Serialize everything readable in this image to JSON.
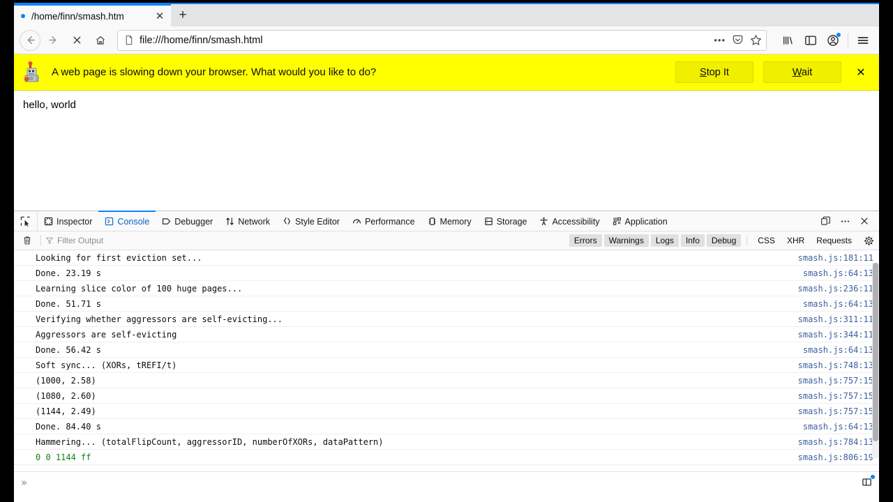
{
  "browser": {
    "tab": {
      "title": "/home/finn/smash.htm",
      "close_label": "✕",
      "loading_indicator": "loading-dot"
    },
    "new_tab_label": "+",
    "nav": {
      "back": "back-icon",
      "forward": "forward-icon",
      "stop": "stop-icon",
      "home": "home-icon"
    },
    "urlbar": {
      "value": "file:///home/finn/smash.html",
      "page_icon": "document-icon",
      "ellipsis": "•••",
      "pocket": "pocket-icon",
      "bookmark": "star-icon"
    },
    "toolbar_right": {
      "library": "library-icon",
      "sidebar": "sidebar-icon",
      "account": "account-icon",
      "menu": "hamburger-menu-icon"
    }
  },
  "notification": {
    "icon": "slow-script-robot-icon",
    "message": "A web page is slowing down your browser. What would you like to do?",
    "stop_button": {
      "prefix": "",
      "accesskey": "S",
      "rest": "top It"
    },
    "wait_button": {
      "prefix": "",
      "accesskey": "W",
      "rest": "ait"
    },
    "close_label": "✕",
    "background": "#ffff00"
  },
  "page": {
    "body_text": "hello, world"
  },
  "devtools": {
    "picker_icon": "element-picker-icon",
    "tabs": [
      {
        "label": "Inspector",
        "icon": "inspector-icon",
        "active": false
      },
      {
        "label": "Console",
        "icon": "console-icon",
        "active": true
      },
      {
        "label": "Debugger",
        "icon": "debugger-icon",
        "active": false
      },
      {
        "label": "Network",
        "icon": "network-icon",
        "active": false
      },
      {
        "label": "Style Editor",
        "icon": "style-editor-icon",
        "active": false
      },
      {
        "label": "Performance",
        "icon": "performance-icon",
        "active": false
      },
      {
        "label": "Memory",
        "icon": "memory-icon",
        "active": false
      },
      {
        "label": "Storage",
        "icon": "storage-icon",
        "active": false
      },
      {
        "label": "Accessibility",
        "icon": "accessibility-icon",
        "active": false
      },
      {
        "label": "Application",
        "icon": "application-icon",
        "active": false
      }
    ],
    "toolbar_right": {
      "dock": "dock-to-side-icon",
      "more": "meatball-menu-icon",
      "close": "close-icon"
    },
    "filterbar": {
      "clear_icon": "trash-icon",
      "filter_icon": "funnel-icon",
      "filter_placeholder": "Filter Output",
      "pills": [
        {
          "label": "Errors",
          "active": true
        },
        {
          "label": "Warnings",
          "active": true
        },
        {
          "label": "Logs",
          "active": true
        },
        {
          "label": "Info",
          "active": true
        },
        {
          "label": "Debug",
          "active": true
        },
        {
          "label": "CSS",
          "active": false
        },
        {
          "label": "XHR",
          "active": false
        },
        {
          "label": "Requests",
          "active": false
        }
      ],
      "settings_icon": "gear-icon"
    },
    "log_rows": [
      {
        "msg": "Looking for first eviction set...",
        "src": "smash.js:181:11",
        "green": false
      },
      {
        "msg": "Done. 23.19 s",
        "src": "smash.js:64:13",
        "green": false
      },
      {
        "msg": "Learning slice color of 100 huge pages...",
        "src": "smash.js:236:11",
        "green": false
      },
      {
        "msg": "Done. 51.71 s",
        "src": "smash.js:64:13",
        "green": false
      },
      {
        "msg": "Verifying whether aggressors are self-evicting...",
        "src": "smash.js:311:11",
        "green": false
      },
      {
        "msg": "Aggressors are self-evicting",
        "src": "smash.js:344:11",
        "green": false
      },
      {
        "msg": "Done. 56.42 s",
        "src": "smash.js:64:13",
        "green": false
      },
      {
        "msg": "Soft sync... (XORs, tREFI/t)",
        "src": "smash.js:748:13",
        "green": false
      },
      {
        "msg": "(1000, 2.58)",
        "src": "smash.js:757:15",
        "green": false
      },
      {
        "msg": "(1080, 2.60)",
        "src": "smash.js:757:15",
        "green": false
      },
      {
        "msg": "(1144, 2.49)",
        "src": "smash.js:757:15",
        "green": false
      },
      {
        "msg": "Done. 84.40 s",
        "src": "smash.js:64:13",
        "green": false
      },
      {
        "msg": "Hammering... (totalFlipCount, aggressorID, numberOfXORs, dataPattern)",
        "src": "smash.js:784:13",
        "green": false
      },
      {
        "msg": "0 0 1144 ff",
        "src": "smash.js:806:19",
        "green": true
      }
    ],
    "prompt": {
      "caret": "»",
      "split_console_icon": "split-console-icon"
    }
  }
}
